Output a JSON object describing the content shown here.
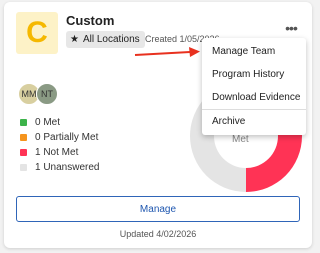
{
  "card": {
    "logo_letter": "C",
    "title": "Custom",
    "location_label": "All Locations",
    "created": "Created 1/05/2026",
    "kebab_glyph": "•••"
  },
  "menu": {
    "items": [
      {
        "label": "Manage Team"
      },
      {
        "label": "Program History"
      },
      {
        "label": "Download Evidence"
      },
      {
        "label": "Archive"
      }
    ]
  },
  "avatars": [
    {
      "initials": "MM"
    },
    {
      "initials": "NT"
    }
  ],
  "legend": [
    {
      "label": "0 Met",
      "color": "#3cb34a"
    },
    {
      "label": "0 Partially Met",
      "color": "#f5941d"
    },
    {
      "label": "1 Not Met",
      "color": "#ff3355"
    },
    {
      "label": "1 Unanswered",
      "color": "#e4e4e4"
    }
  ],
  "donut": {
    "center_text": "Met",
    "segments": [
      {
        "name": "Not Met",
        "value": 1,
        "color": "#ff3355"
      },
      {
        "name": "Unanswered",
        "value": 1,
        "color": "#e4e4e4"
      }
    ]
  },
  "manage_label": "Manage",
  "updated": "Updated 4/02/2026",
  "colors": {
    "accent": "#1f57b0",
    "annotation_arrow": "#e8311f"
  }
}
